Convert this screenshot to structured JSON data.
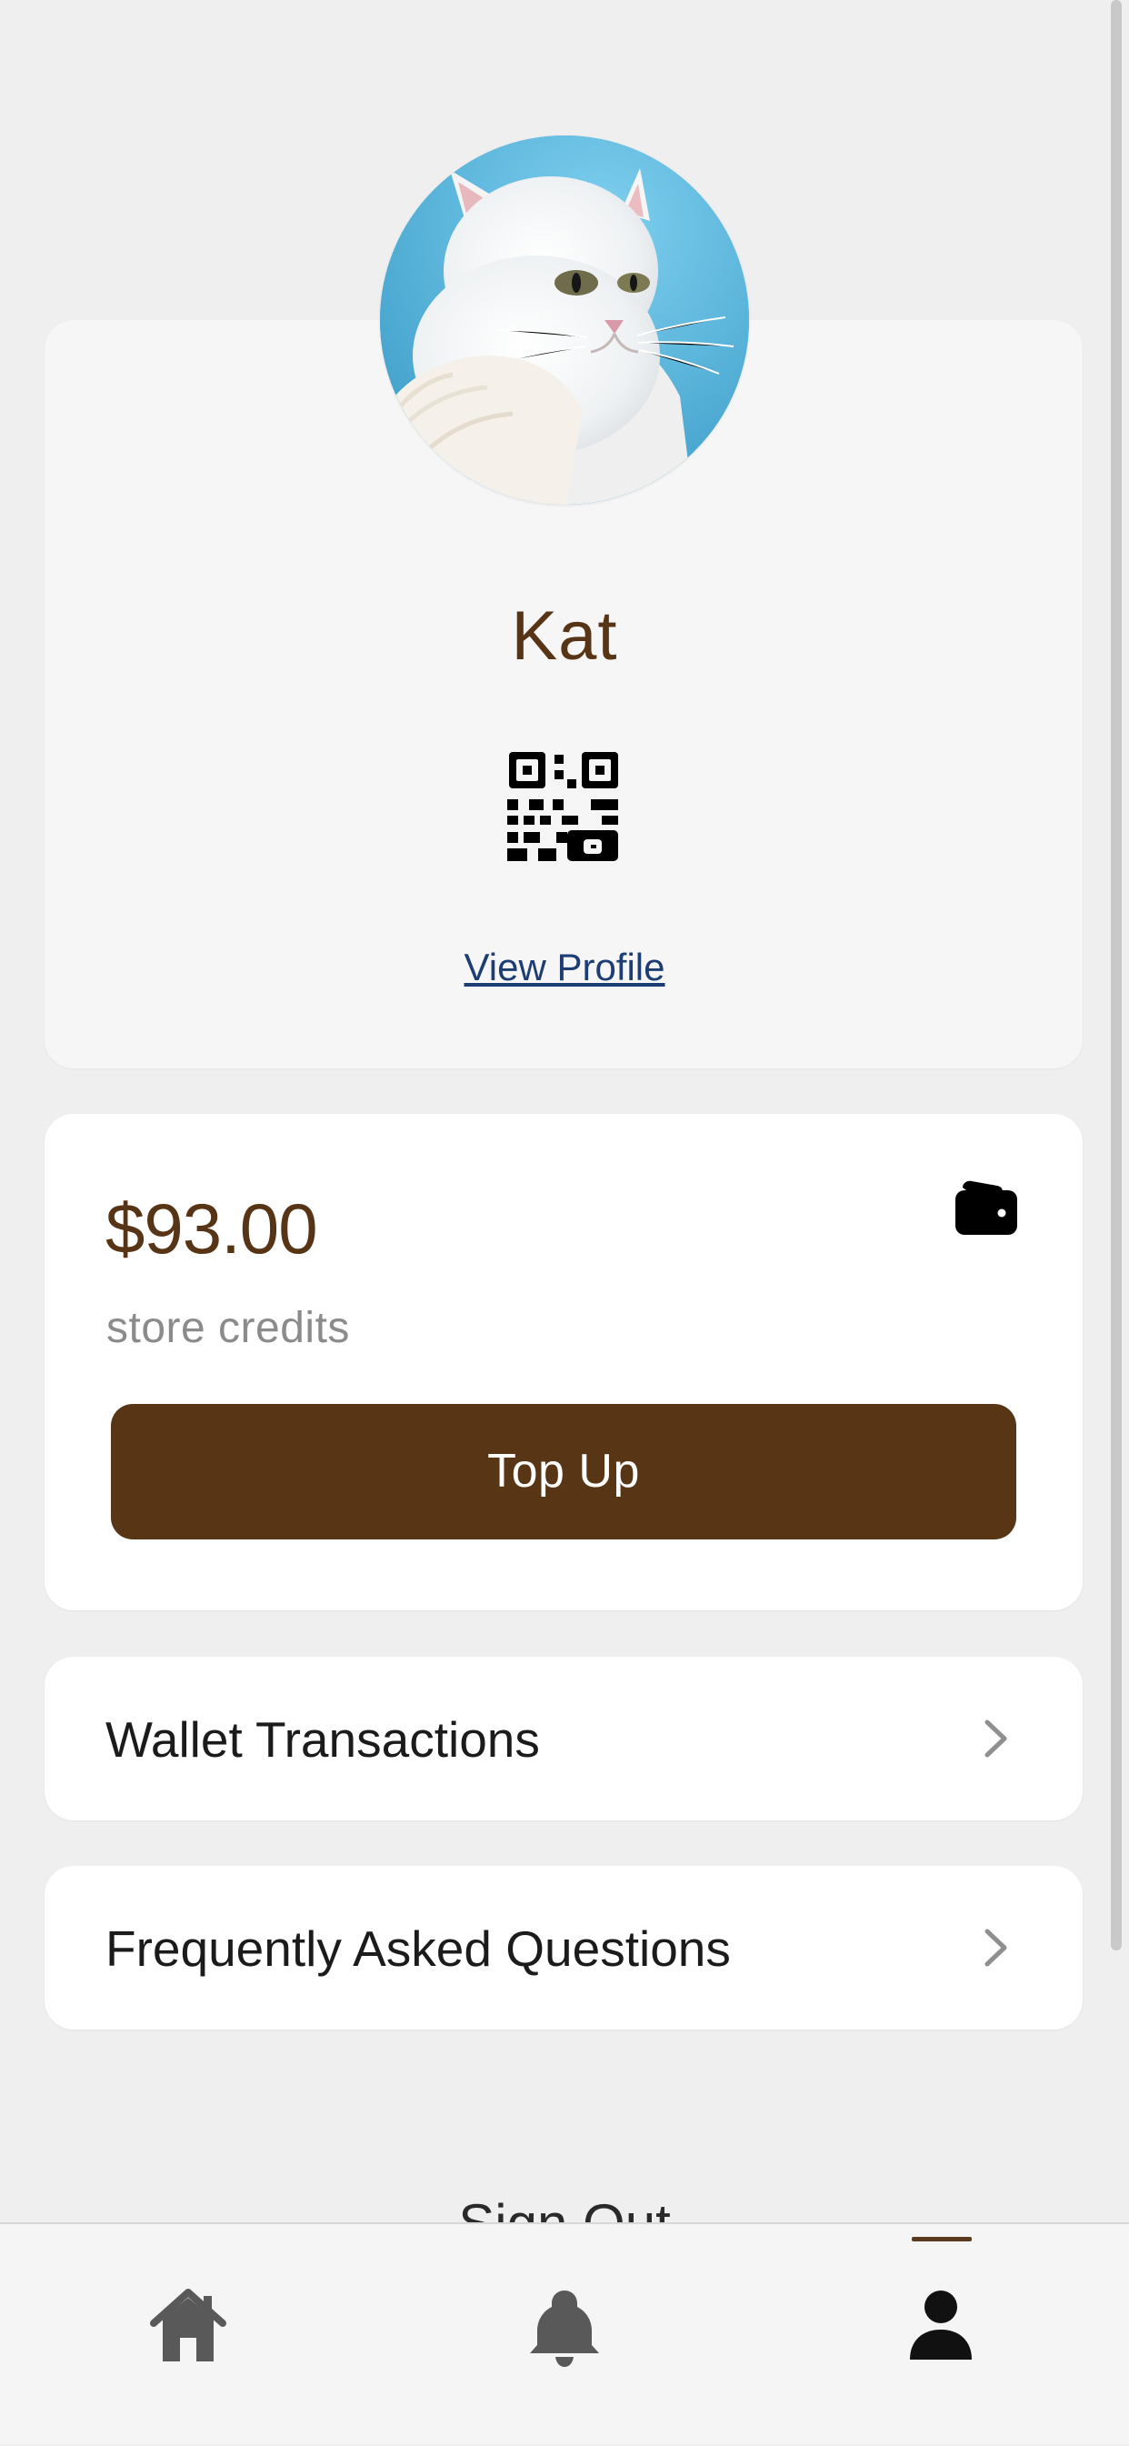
{
  "profile": {
    "name": "Kat",
    "view_profile_label": "View Profile",
    "avatar": "white-cat-photo",
    "qr_icon": "qr-code-icon"
  },
  "wallet": {
    "balance": "$93.00",
    "balance_label": "store credits",
    "top_up_label": "Top Up",
    "icon": "wallet-icon"
  },
  "menu": {
    "items": [
      {
        "label": "Wallet Transactions",
        "icon": "chevron-right-icon"
      },
      {
        "label": "Frequently Asked Questions",
        "icon": "chevron-right-icon"
      }
    ]
  },
  "sign_out_label": "Sign Out",
  "bottom_nav": {
    "items": [
      {
        "icon": "home-icon",
        "active": false
      },
      {
        "icon": "bell-icon",
        "active": false
      },
      {
        "icon": "user-icon",
        "active": true
      }
    ]
  },
  "colors": {
    "brand_brown": "#573515",
    "link_blue": "#1c3e74",
    "background": "#efefef",
    "card_white": "#ffffff"
  }
}
